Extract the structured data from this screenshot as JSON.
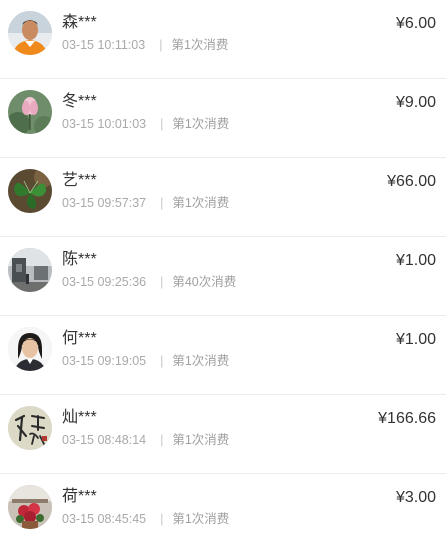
{
  "records": [
    {
      "name": "森***",
      "time": "03-15 10:11:03",
      "separator": "|",
      "count": "第1次消费",
      "amount": "¥6.00",
      "avatar": "avatar-man-orange-shirt"
    },
    {
      "name": "冬***",
      "time": "03-15 10:01:03",
      "separator": "|",
      "count": "第1次消费",
      "amount": "¥9.00",
      "avatar": "avatar-lotus-flower"
    },
    {
      "name": "艺***",
      "time": "03-15 09:57:37",
      "separator": "|",
      "count": "第1次消费",
      "amount": "¥66.00",
      "avatar": "avatar-green-leaf"
    },
    {
      "name": "陈***",
      "time": "03-15 09:25:36",
      "separator": "|",
      "count": "第40次消费",
      "amount": "¥1.00",
      "avatar": "avatar-street-scene"
    },
    {
      "name": "何***",
      "time": "03-15 09:19:05",
      "separator": "|",
      "count": "第1次消费",
      "amount": "¥1.00",
      "avatar": "avatar-woman-portrait"
    },
    {
      "name": "灿***",
      "time": "03-15 08:48:14",
      "separator": "|",
      "count": "第1次消费",
      "amount": "¥166.66",
      "avatar": "avatar-calligraphy"
    },
    {
      "name": "荷***",
      "time": "03-15 08:45:45",
      "separator": "|",
      "count": "第1次消费",
      "amount": "¥3.00",
      "avatar": "avatar-flower-pot"
    }
  ]
}
